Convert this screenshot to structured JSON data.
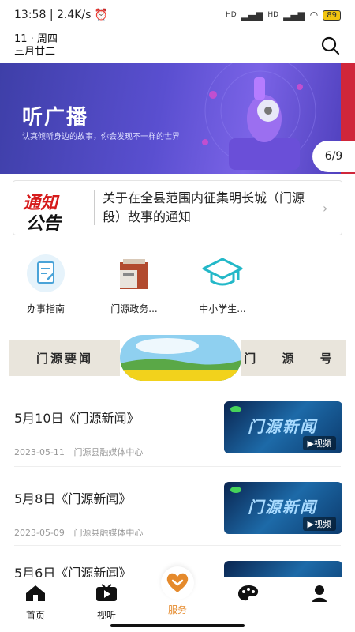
{
  "status_bar": {
    "time": "13:58",
    "speed": "2.4K/s",
    "net": "HD",
    "battery": "89"
  },
  "header": {
    "date_line1": "11 · 周四",
    "date_line2": "三月廿二"
  },
  "banner": {
    "title": "听广播",
    "subtitle": "认真倾听身边的故事，你会发现不一样的世界",
    "page_indicator": "6/9"
  },
  "notice": {
    "logo_line1": "通知",
    "logo_line2": "公告",
    "text": "关于在全县范围内征集明长城（门源段）故事的通知"
  },
  "services": [
    {
      "label": "办事指南",
      "icon": "guide-icon"
    },
    {
      "label": "门源政务...",
      "icon": "building-icon"
    },
    {
      "label": "中小学生...",
      "icon": "graduation-cap-icon"
    }
  ],
  "nav_banner": {
    "left": "门源要闻",
    "right": "门 源 号"
  },
  "news": [
    {
      "title": "5月10日《门源新闻》",
      "date": "2023-05-11",
      "source": "门源县融媒体中心",
      "thumb_label": "▶视频",
      "thumb_title": "门源新闻"
    },
    {
      "title": "5月8日《门源新闻》",
      "date": "2023-05-09",
      "source": "门源县融媒体中心",
      "thumb_label": "▶视频",
      "thumb_title": "门源新闻"
    },
    {
      "title": "5月6日《门源新闻》",
      "date": "",
      "source": "",
      "thumb_label": "",
      "thumb_title": ""
    }
  ],
  "tabbar": [
    {
      "label": "首页",
      "icon": "home-icon"
    },
    {
      "label": "视听",
      "icon": "play-video-icon"
    },
    {
      "label": "服务",
      "icon": "heart-service-icon"
    },
    {
      "label": "",
      "icon": "palette-icon"
    },
    {
      "label": "",
      "icon": "profile-icon"
    }
  ],
  "colors": {
    "accent": "#e58a2c",
    "banner": "#5a4fd0",
    "notice_red": "#d61a1a"
  }
}
